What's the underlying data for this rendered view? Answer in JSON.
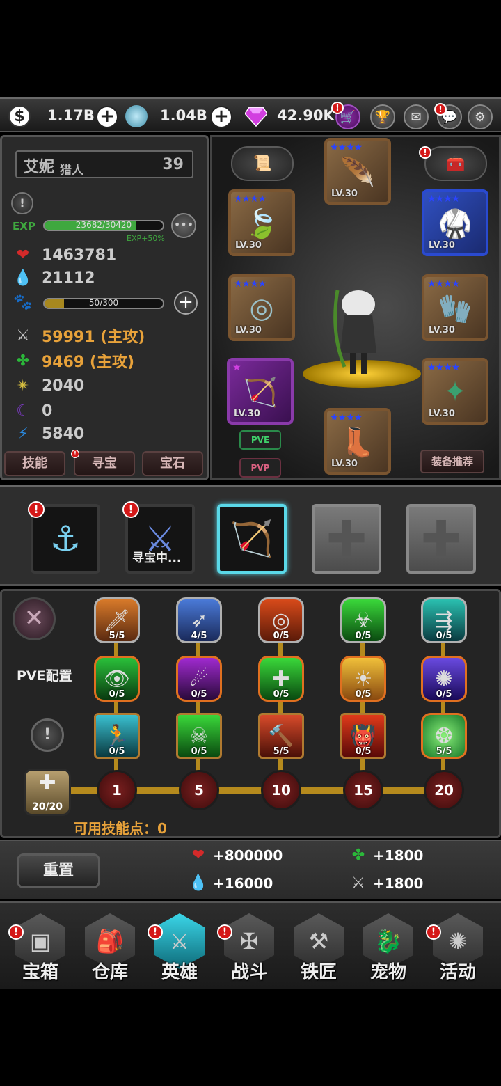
{
  "currency": {
    "gold": "1.17B",
    "crystal": "1.04B",
    "gems": "42.90K"
  },
  "hero": {
    "name": "艾妮",
    "class": "猎人",
    "level": "39",
    "exp_label": "EXP",
    "exp_text": "23682/30420",
    "exp_progress": 0.778,
    "exp_bonus": "EXP+50%",
    "hp": "1463781",
    "mp": "21112",
    "pet_text": "50/300",
    "pet_progress": 0.167,
    "attack": "59991 (主攻)",
    "magic": "9469 (主攻)",
    "crit": "2040",
    "dark": "0",
    "speed": "5840"
  },
  "hero_tabs": [
    "技能",
    "寻宝",
    "宝石"
  ],
  "equipment": {
    "slots": [
      {
        "name": "helmet",
        "stars": "★★★★",
        "level": "LV.30",
        "icon": "feather-helmet-icon"
      },
      {
        "name": "necklace",
        "stars": "★★★★",
        "level": "LV.30",
        "icon": "leaf-icon"
      },
      {
        "name": "armor",
        "stars": "★★★★",
        "level": "LV.30",
        "icon": "armor-icon"
      },
      {
        "name": "ring",
        "stars": "★★★★",
        "level": "LV.30",
        "icon": "ring-icon"
      },
      {
        "name": "gloves",
        "stars": "★★★★",
        "level": "LV.30",
        "icon": "gloves-icon"
      },
      {
        "name": "weapon",
        "stars": "★",
        "level": "LV.30",
        "icon": "bow-icon"
      },
      {
        "name": "shuriken",
        "stars": "★★★★",
        "level": "LV.30",
        "icon": "shuriken-icon"
      },
      {
        "name": "boots",
        "stars": "★★★★",
        "level": "LV.30",
        "icon": "boots-icon"
      }
    ],
    "pve": "PVE",
    "pvp": "PVP",
    "recommend": "装备推荐"
  },
  "skill_trees": {
    "searching_label": "寻宝中..."
  },
  "skills": {
    "config_label": "PVE配置",
    "rows": [
      [
        "5/5",
        "4/5",
        "0/5",
        "0/5",
        "0/5"
      ],
      [
        "0/5",
        "0/5",
        "0/5",
        "0/5",
        "0/5"
      ],
      [
        "0/5",
        "0/5",
        "5/5",
        "0/5",
        "5/5"
      ]
    ],
    "tiers": [
      "1",
      "5",
      "10",
      "15",
      "20"
    ],
    "total_points": "20/20",
    "available_label": "可用技能点：0"
  },
  "bonus": {
    "reset_label": "重置",
    "hp": "+800000",
    "magic": "+1800",
    "mp": "+16000",
    "attack": "+1800"
  },
  "nav": [
    {
      "label": "宝箱",
      "icon": "chest-icon",
      "alert": true
    },
    {
      "label": "仓库",
      "icon": "backpack-icon",
      "alert": false
    },
    {
      "label": "英雄",
      "icon": "sword-icon",
      "alert": true
    },
    {
      "label": "战斗",
      "icon": "battle-icon",
      "alert": true
    },
    {
      "label": "铁匠",
      "icon": "anvil-icon",
      "alert": false
    },
    {
      "label": "宠物",
      "icon": "pet-icon",
      "alert": false
    },
    {
      "label": "活动",
      "icon": "event-icon",
      "alert": true
    }
  ],
  "colors": {
    "exp_bar": "#3fa83f",
    "pet_bar": "#a7881f",
    "gold_text": "#e8a23a",
    "active_nav": "#3bd6e8",
    "alert": "#d41818"
  }
}
